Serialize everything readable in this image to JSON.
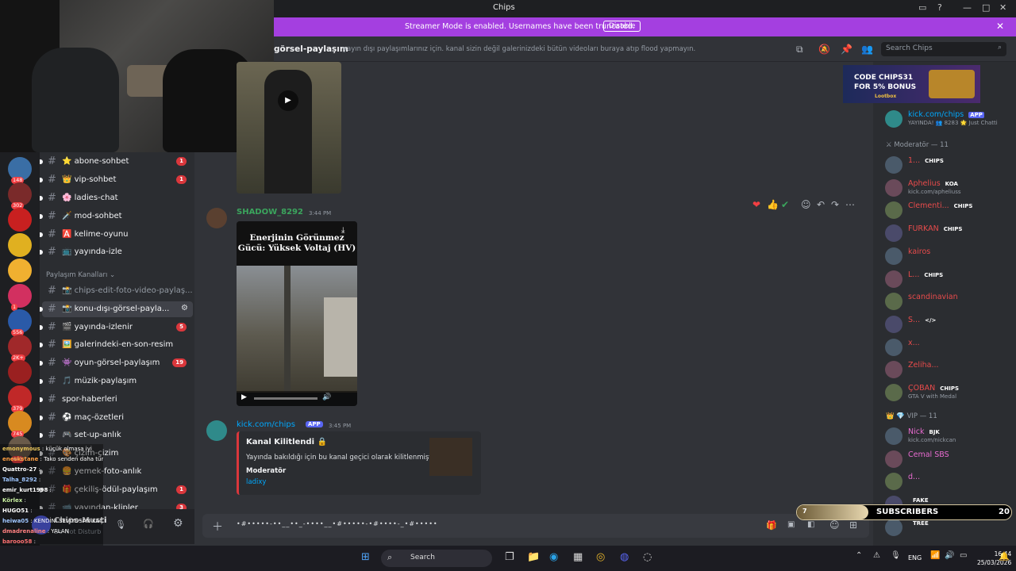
{
  "app": {
    "title": "Chips"
  },
  "banner": {
    "message": "Streamer Mode is enabled. Usernames have been truncated.",
    "disable_label": "Disable"
  },
  "channel_header": {
    "name": "görsel-paylaşım",
    "topic": "yayın dışı paylaşımlarınız için. kanal sizin değil galerinizdeki bütün videoları buraya atıp flood yapmayın.",
    "search_placeholder": "Search Chips"
  },
  "server_list": [
    {
      "badge": "148",
      "color": "#3a6ea5"
    },
    {
      "badge": "302",
      "color": "#7a2a2a"
    },
    {
      "badge": "",
      "color": "#c82020"
    },
    {
      "badge": "",
      "color": "#e0b020"
    },
    {
      "badge": "",
      "color": "#f0b030"
    },
    {
      "badge": "1",
      "color": "#d23060"
    },
    {
      "badge": "556",
      "color": "#2a5aa8"
    },
    {
      "badge": "2K+",
      "color": "#a0282a"
    },
    {
      "badge": "",
      "color": "#9a2020"
    },
    {
      "badge": "379",
      "color": "#c02828"
    },
    {
      "badge": "745",
      "color": "#d88a20"
    },
    {
      "badge": "441",
      "color": "#6a5a4a"
    }
  ],
  "channels": {
    "category_label": "Paylaşım Kanalları",
    "items": [
      {
        "name": "⭐ abone-sohbet",
        "badge": "1",
        "unread": true
      },
      {
        "name": "👑 vip-sohbet",
        "badge": "1",
        "unread": true
      },
      {
        "name": "🌸 ladies-chat",
        "badge": "",
        "unread": true
      },
      {
        "name": "🗡️ mod-sohbet",
        "badge": "",
        "unread": true
      },
      {
        "name": "🅰️ kelime-oyunu",
        "badge": "",
        "unread": true
      },
      {
        "name": "📺 yayında-izle",
        "badge": "",
        "unread": true
      },
      {
        "name": "📸 chips-edit-foto-video-paylaş...",
        "badge": "",
        "unread": false
      },
      {
        "name": "📸 konu-dışı-görsel-payla...",
        "badge": "",
        "unread": true,
        "active": true
      },
      {
        "name": "🎬 yayında-izlenir",
        "badge": "5",
        "unread": true
      },
      {
        "name": "🖼️ galerindeki-en-son-resim",
        "badge": "",
        "unread": true
      },
      {
        "name": "👾 oyun-görsel-paylaşım",
        "badge": "19",
        "unread": true
      },
      {
        "name": "🎵 müzik-paylaşım",
        "badge": "",
        "unread": true
      },
      {
        "name": "spor-haberleri",
        "badge": "",
        "unread": true
      },
      {
        "name": "⚽ maç-özetleri",
        "badge": "",
        "unread": true
      },
      {
        "name": "🎮 set-up-anlık",
        "badge": "",
        "unread": true
      },
      {
        "name": "🎨 çizim-çizim",
        "badge": "",
        "unread": true
      },
      {
        "name": "🍔 yemek-foto-anlık",
        "badge": "",
        "unread": true
      },
      {
        "name": "🎁 çekiliş-ödül-paylaşım",
        "badge": "1",
        "unread": true
      },
      {
        "name": "📹 yayından-klipler",
        "badge": "3",
        "unread": true
      }
    ]
  },
  "user_panel": {
    "name": "Chips-Musti",
    "status": "Do Not Disturb"
  },
  "overlay_chat": [
    {
      "user": "emonymous",
      "text": ": küçük olmasa iyi",
      "color": "#e6c35a"
    },
    {
      "user": "eneskstane",
      "text": ": Tako senden daha türk amk",
      "color": "#ff9f43"
    },
    {
      "user": "Quattro-27",
      "text": ":",
      "color": "#ffffff"
    },
    {
      "user": "Talha_8292",
      "text": ":",
      "color": "#9fc6ff"
    },
    {
      "user": "emir_kurt1998",
      "text": ":",
      "color": "#ffffff"
    },
    {
      "user": "Körlex",
      "text": ":",
      "color": "#c8f0a0"
    },
    {
      "user": "HUGO51",
      "text": ":",
      "color": "#ffffff"
    },
    {
      "user": "",
      "text": "",
      "color": "#ffffff"
    },
    {
      "user": "heiwa05",
      "text": ": KENDİNİ SEVİYOSAN KAÇ",
      "color": "#9fc6ff"
    },
    {
      "user": "dmadrenaline",
      "text": ": YALAN",
      "color": "#ff8080"
    },
    {
      "user": "barooo58",
      "text": ":",
      "color": "#ff7070"
    }
  ],
  "messages": [
    {
      "author": "SHADOW_8292",
      "time": "3:44 PM",
      "video_title": "Enerjinin Görünmez Gücü: Yüksek Voltaj (HV)"
    },
    {
      "author": "kick.com/chips",
      "badge": "APP",
      "time": "3:45 PM",
      "embed": {
        "title": "Kanal Kilitlendi 🔒",
        "description": "Yayında bakıldığı için bu kanal geçici olarak kilitlenmiştir.",
        "field_name": "Moderatör",
        "field_value": "ladixy"
      }
    }
  ],
  "composer": {
    "text": "•#•••••-••__••_-••••__•#•••••-•#••••-_•#•••••"
  },
  "members": {
    "ad_text": "CODE CHIPS31 FOR 5% BONUS",
    "ad_sub": "Lootbox",
    "app_member": {
      "name": "kick.com/chips",
      "badge": "APP",
      "status": "YAYINDA! 👥 8283 🌟 Just Chatti"
    },
    "moderator_header": "Moderatör — 11",
    "moderators": [
      {
        "name": "1...",
        "tag": "CHIPS",
        "color": "#e84b4b",
        "sub": ""
      },
      {
        "name": "Aphelius",
        "tag": "KOA",
        "color": "#e84b4b",
        "sub": "kick.com/apheliuss"
      },
      {
        "name": "Clementi...",
        "tag": "CHIPS",
        "color": "#e84b4b",
        "sub": ""
      },
      {
        "name": "FURKAN",
        "tag": "CHIPS",
        "color": "#e84b4b",
        "sub": ""
      },
      {
        "name": "kairos",
        "tag": "",
        "color": "#e84b4b",
        "sub": ""
      },
      {
        "name": "L...",
        "tag": "CHIPS",
        "color": "#e84b4b",
        "sub": ""
      },
      {
        "name": "scandinavian",
        "tag": "",
        "color": "#e84b4b",
        "sub": ""
      },
      {
        "name": "S...",
        "tag": "</>",
        "color": "#e84b4b",
        "sub": ""
      },
      {
        "name": "x...",
        "tag": "",
        "color": "#e84b4b",
        "sub": ""
      },
      {
        "name": "Zeliha...",
        "tag": "",
        "color": "#e84b4b",
        "sub": ""
      },
      {
        "name": "ÇOBAN",
        "tag": "CHIPS",
        "color": "#e84b4b",
        "sub": "GTA V with Medal"
      }
    ],
    "vip_header": "VIP — 11",
    "vips": [
      {
        "name": "Nick",
        "tag": "BJK",
        "color": "#e86bd0",
        "sub": "kick.com/nickcan"
      },
      {
        "name": "Cemal SBS",
        "tag": "",
        "color": "#e86bd0",
        "sub": ""
      },
      {
        "name": "d...",
        "tag": "",
        "color": "#e86bd0",
        "sub": ""
      },
      {
        "name": "",
        "tag": "FAKE",
        "color": "#e86bd0",
        "sub": ""
      },
      {
        "name": "",
        "tag": "TREE",
        "color": "#e86bd0",
        "sub": ""
      }
    ]
  },
  "subscribers": {
    "label": "SUBSCRIBERS",
    "count": "20",
    "progress_label": "7"
  },
  "taskbar": {
    "search": "Search",
    "lang": "ENG",
    "time": "16:44",
    "date": "25/03/2026"
  }
}
